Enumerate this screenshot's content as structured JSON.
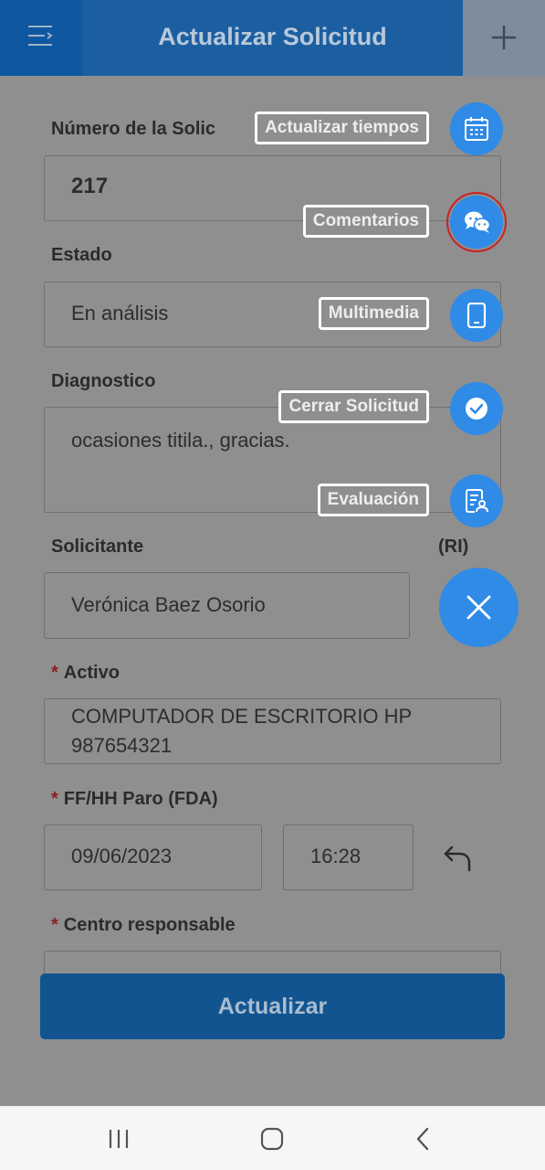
{
  "header": {
    "title": "Actualizar Solicitud"
  },
  "form": {
    "numero_label": "Número de la Solic",
    "numero_value": "217",
    "estado_label": "Estado",
    "estado_value": "En análisis",
    "diagnostico_label": "Diagnostico",
    "diagnostico_value": "ocasiones titila., gracias.",
    "solicitante_label": "Solicitante",
    "solicitante_suffix": "(RI)",
    "solicitante_value": "Verónica Baez Osorio",
    "activo_label": "Activo",
    "activo_line1": "COMPUTADOR DE ESCRITORIO HP",
    "activo_line2": "987654321",
    "ffhh_label": "FF/HH Paro (FDA)",
    "fecha_value": "09/06/2023",
    "hora_value": "16:28",
    "centro_label": "Centro responsable",
    "required_mark": "*"
  },
  "speed_dial": {
    "items": [
      {
        "label": "Actualizar tiempos",
        "icon": "calendar-icon"
      },
      {
        "label": "Comentarios",
        "icon": "chat-icon"
      },
      {
        "label": "Multimedia",
        "icon": "tablet-icon"
      },
      {
        "label": "Cerrar Solicitud",
        "icon": "check-circle-icon"
      },
      {
        "label": "Evaluación",
        "icon": "evaluation-icon"
      }
    ],
    "close_icon": "close-icon"
  },
  "actions": {
    "update_label": "Actualizar"
  },
  "colors": {
    "primary": "#2f8be6",
    "header": "#1c5fa0",
    "backdrop": "#8f8f8f",
    "highlight_ring": "#cc2222"
  }
}
